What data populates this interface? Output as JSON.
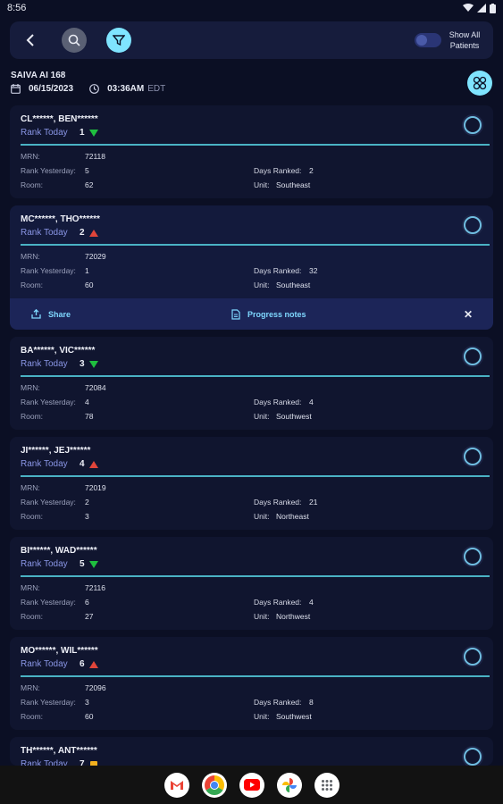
{
  "status_bar": {
    "time": "8:56"
  },
  "toolbar": {
    "toggle_label": "Show All Patients"
  },
  "header": {
    "device": "SAIVA AI 168",
    "date": "06/15/2023",
    "time": "03:36AM",
    "timezone": "EDT"
  },
  "labels": {
    "rank_today": "Rank Today",
    "mrn": "MRN:",
    "rank_yesterday": "Rank Yesterday:",
    "room": "Room:",
    "days_ranked": "Days Ranked:",
    "unit": "Unit:"
  },
  "actions": {
    "share": "Share",
    "progress_notes": "Progress notes",
    "close": "✕"
  },
  "colors": {
    "up": "#1fbf3f",
    "down": "#e0453a",
    "same": "#f2b01e",
    "accent": "#7fe4ff"
  },
  "patients": [
    {
      "name": "CL******, BEN******",
      "rank": "1",
      "trend": "down-green",
      "mrn": "72118",
      "rank_yesterday": "5",
      "room": "62",
      "days_ranked": "2",
      "unit": "Southeast"
    },
    {
      "name": "MC******, THO******",
      "rank": "2",
      "trend": "up-red",
      "mrn": "72029",
      "rank_yesterday": "1",
      "room": "60",
      "days_ranked": "32",
      "unit": "Southeast"
    },
    {
      "name": "BA******, VIC******",
      "rank": "3",
      "trend": "down-green",
      "mrn": "72084",
      "rank_yesterday": "4",
      "room": "78",
      "days_ranked": "4",
      "unit": "Southwest"
    },
    {
      "name": "JI******, JEJ******",
      "rank": "4",
      "trend": "up-red",
      "mrn": "72019",
      "rank_yesterday": "2",
      "room": "3",
      "days_ranked": "21",
      "unit": "Northeast"
    },
    {
      "name": "BI******, WAD******",
      "rank": "5",
      "trend": "down-green",
      "mrn": "72116",
      "rank_yesterday": "6",
      "room": "27",
      "days_ranked": "4",
      "unit": "Northwest"
    },
    {
      "name": "MO******, WIL******",
      "rank": "6",
      "trend": "up-red",
      "mrn": "72096",
      "rank_yesterday": "3",
      "room": "60",
      "days_ranked": "8",
      "unit": "Southwest"
    },
    {
      "name": "TH******, ANT******",
      "rank": "7",
      "trend": "same"
    }
  ]
}
